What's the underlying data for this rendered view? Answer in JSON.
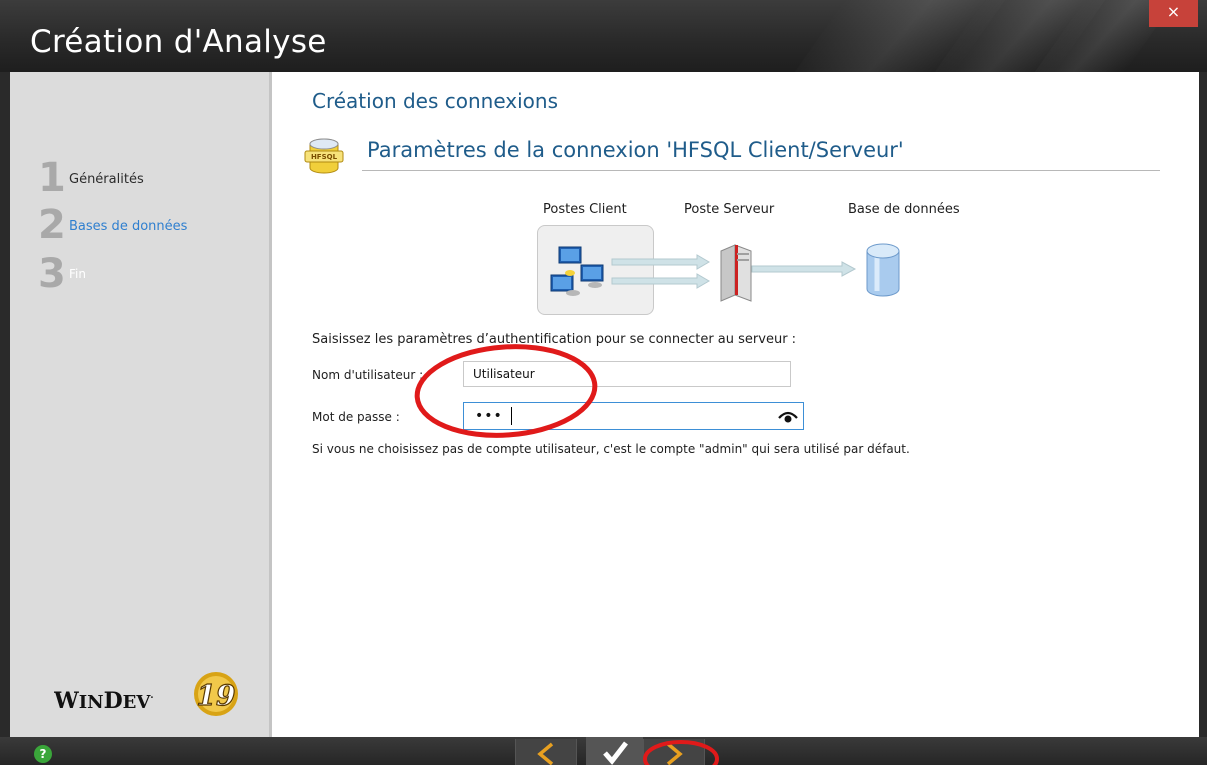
{
  "window": {
    "title": "Création d'Analyse",
    "close_label": "×"
  },
  "wizard_steps": [
    {
      "number": "1",
      "label": "Généralités",
      "state": "done"
    },
    {
      "number": "2",
      "label": "Bases de données",
      "state": "current"
    },
    {
      "number": "3",
      "label": "Fin",
      "state": "pending"
    }
  ],
  "logo": {
    "text": "WinDev",
    "version": "19"
  },
  "page": {
    "heading": "Création des connexions",
    "subheading": "Paramètres de la connexion 'HFSQL Client/Serveur'",
    "db_icon_text": "HFSQL"
  },
  "diagram": {
    "client_label": "Postes Client",
    "server_label": "Poste Serveur",
    "database_label": "Base de données"
  },
  "form": {
    "instruction": "Saisissez les paramètres d’authentification pour se connecter au serveur :",
    "username_label": "Nom d'utilisateur :",
    "username_value": "Utilisateur",
    "password_label": "Mot de passe :",
    "password_value": "•••",
    "note": "Si vous ne choisissez pas de compte utilisateur, c'est le compte \"admin\" qui sera utilisé par défaut."
  },
  "bottom_bar": {
    "help_label": "?",
    "prev_icon": "chevron-left-icon",
    "ok_icon": "check-icon",
    "next_icon": "chevron-right-icon"
  },
  "colors": {
    "heading": "#1f5c8a",
    "current_step": "#2f7fcf",
    "annotation": "#e01a1a",
    "nav_accent": "#e8a020"
  }
}
